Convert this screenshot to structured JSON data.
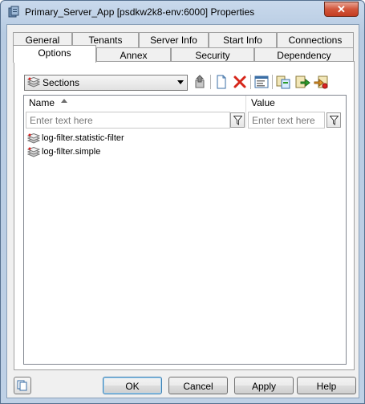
{
  "window": {
    "title": "Primary_Server_App [psdkw2k8-env:6000] Properties",
    "close_glyph": "✕"
  },
  "tabs": {
    "row_top": [
      {
        "label": "General",
        "name": "tab-general"
      },
      {
        "label": "Tenants",
        "name": "tab-tenants"
      },
      {
        "label": "Server Info",
        "name": "tab-server-info"
      },
      {
        "label": "Start Info",
        "name": "tab-start-info"
      },
      {
        "label": "Connections",
        "name": "tab-connections"
      }
    ],
    "row_bottom": [
      {
        "label": "Options",
        "name": "tab-options",
        "active": true
      },
      {
        "label": "Annex",
        "name": "tab-annex"
      },
      {
        "label": "Security",
        "name": "tab-security"
      },
      {
        "label": "Dependency",
        "name": "tab-dependency"
      }
    ]
  },
  "toolbar": {
    "view_select": {
      "value": "Sections",
      "icon": "sections-icon"
    },
    "buttons": [
      {
        "name": "up-level-button",
        "icon": "up-level-icon"
      },
      {
        "name": "new-button",
        "icon": "new-document-icon"
      },
      {
        "name": "delete-button",
        "icon": "delete-x-icon"
      },
      {
        "name": "properties-button",
        "icon": "properties-icon"
      },
      {
        "name": "copy-button",
        "icon": "copy-icon"
      },
      {
        "name": "export-button",
        "icon": "export-icon"
      },
      {
        "name": "import-button",
        "icon": "import-icon"
      }
    ]
  },
  "grid": {
    "columns": [
      {
        "label": "Name",
        "sorted": "ascending"
      },
      {
        "label": "Value"
      }
    ],
    "filter_placeholders": {
      "name": "Enter text here",
      "value": "Enter text here"
    },
    "rows": [
      {
        "label": "log-filter.statistic-filter",
        "icon": "section-icon"
      },
      {
        "label": "log-filter.simple",
        "icon": "section-icon"
      }
    ]
  },
  "footer": {
    "ok_label": "OK",
    "cancel_label": "Cancel",
    "apply_label": "Apply",
    "help_label": "Help"
  },
  "colors": {
    "title_bar": "#bfd1e6",
    "close_button": "#c43d22",
    "delete_icon": "#d6261a",
    "default_button_border": "#3c7fb1"
  }
}
